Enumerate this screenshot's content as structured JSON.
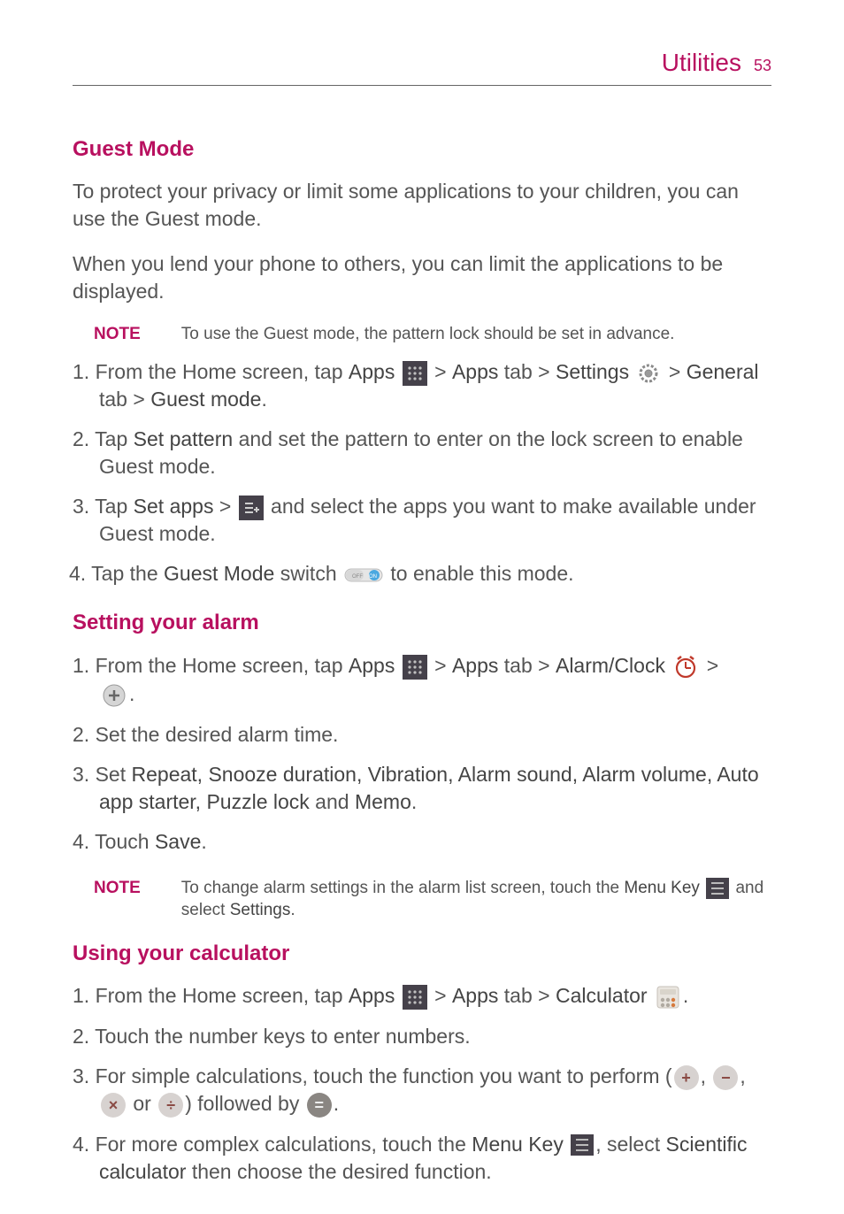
{
  "header": {
    "section": "Utilities",
    "page": "53"
  },
  "guest_mode": {
    "title": "Guest Mode",
    "para1": "To protect your privacy or limit some applications to your children, you can use the Guest mode.",
    "para2": "When you lend your phone to others, you can limit the applications to be displayed.",
    "note_label": "NOTE",
    "note_text": "To use the Guest mode, the pattern lock should be set in advance.",
    "s1_p1": "From the Home screen, tap ",
    "s1_apps": "Apps",
    "s1_arrow1": " > ",
    "s1_apps_tab": "Apps",
    "s1_tab_word": " tab > ",
    "s1_settings": "Settings",
    "s1_arrow2": " > ",
    "s1_general": "General",
    "s1_tab_word2": " tab > ",
    "s1_guest_mode": "Guest mode",
    "s1_period": ".",
    "s2_p1": "Tap ",
    "s2_set_pattern": "Set pattern",
    "s2_p2": " and set the pattern to enter on the lock screen to enable Guest mode.",
    "s3_p1": "Tap ",
    "s3_set_apps": "Set apps",
    "s3_arrow": " > ",
    "s3_p2": " and select the apps you want to make available under Guest mode.",
    "s4_p1": "Tap the ",
    "s4_switch": "Guest Mode",
    "s4_p2": " switch ",
    "s4_p3": " to enable this mode."
  },
  "alarm": {
    "title": "Setting your alarm",
    "s1_p1": "From the Home screen, tap ",
    "s1_apps": "Apps",
    "s1_arrow1": " > ",
    "s1_apps_tab": "Apps",
    "s1_tab_word": " tab > ",
    "s1_alarm": "Alarm/Clock",
    "s1_arrow2": " > ",
    "s1_period": ".",
    "s2": "Set the desired alarm time.",
    "s3_p1": "Set ",
    "s3_bolds": "Repeat, Snooze duration, Vibration, Alarm sound, Alarm volume, Auto app starter, Puzzle lock",
    "s3_and": " and ",
    "s3_memo": "Memo",
    "s3_period": ".",
    "s4_p1": "Touch ",
    "s4_save": "Save",
    "s4_period": ".",
    "note_label": "NOTE",
    "note_p1": "To change alarm settings in the alarm list screen, touch the ",
    "note_menu": "Menu Key",
    "note_p2": " and select ",
    "note_settings": "Settings",
    "note_period": "."
  },
  "calc": {
    "title": "Using your calculator",
    "s1_p1": "From the Home screen, tap ",
    "s1_apps": "Apps",
    "s1_arrow1": " > ",
    "s1_apps_tab": "Apps",
    "s1_tab_word": " tab > ",
    "s1_calculator": "Calculator",
    "s1_period": ".",
    "s2": "Touch the number keys to enter numbers.",
    "s3_p1": "For simple calculations, touch the function you want to perform (",
    "s3_comma": ", ",
    "s3_or": " or ",
    "s3_follow": ") followed by ",
    "s3_period": ".",
    "s4_p1": "For more complex calculations, touch the ",
    "s4_menu": "Menu Key",
    "s4_p2": ", select ",
    "s4_sci": "Scientific calculator",
    "s4_p3": " then choose the desired function.",
    "keys": {
      "plus": "+",
      "minus": "−",
      "times": "×",
      "divide": "÷",
      "equals": "="
    }
  },
  "chart_data": null
}
